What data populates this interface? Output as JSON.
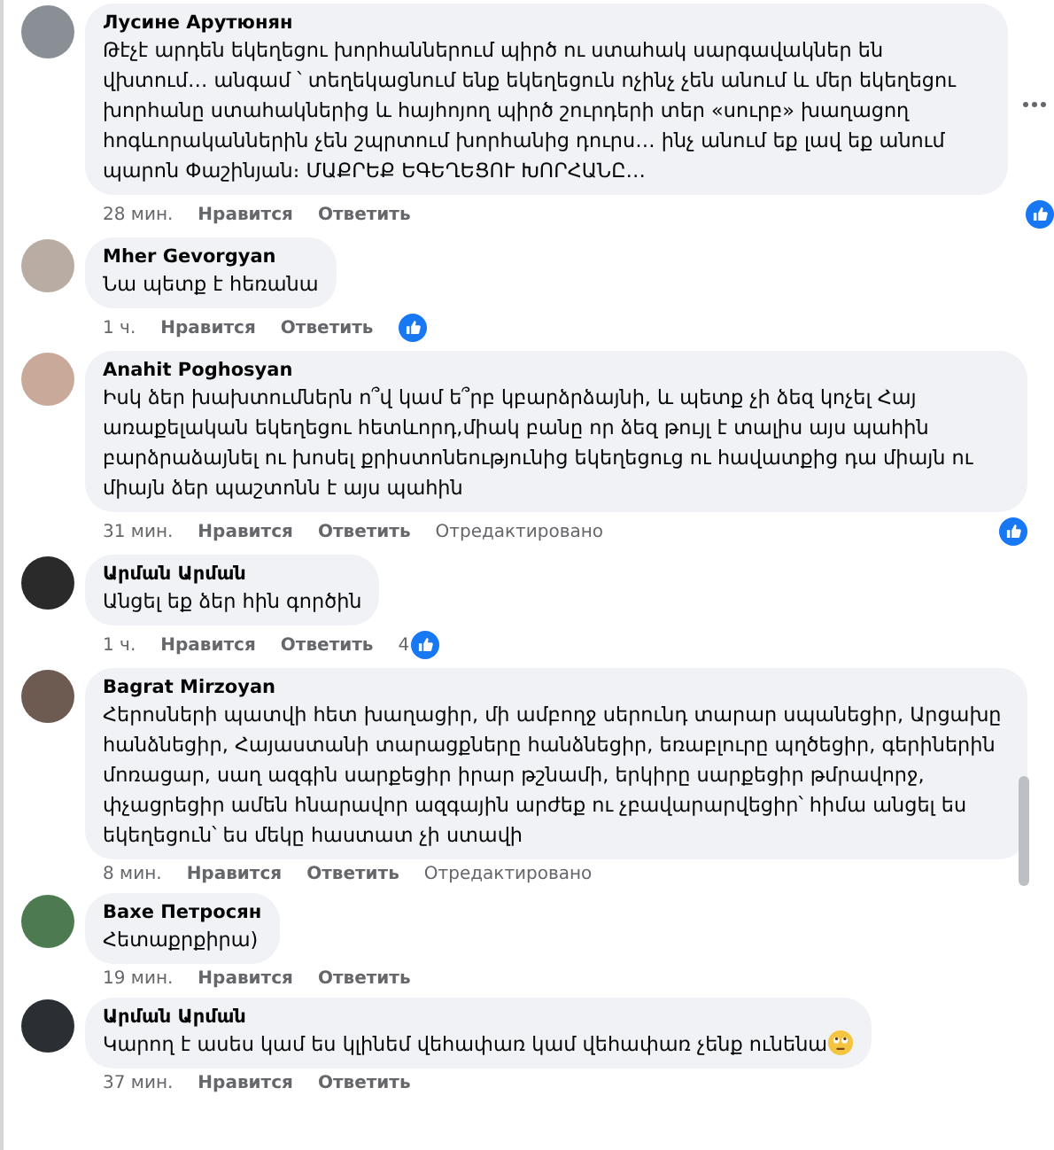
{
  "comments": [
    {
      "author": "Лусине Арутюнян",
      "text": "Թէչէ արդեն եկեղեցու խորհաններում պիրծ ու ստահակ սարգավակներ են վխտում… անգամ ՝ տեղեկացնում ենք եկեղեցուն ոչինչ չեն անում և մեր եկեղեցու խորհանը ստահակներից և հայհոյող պիրծ շուրդերի տեր «սուրբ» խաղացող հոգևորականներին չեն շպրտում խորհանից դուրս… ինչ անում եք լավ եք անում պարոն Փաշինյան։ ՄԱՔՐԵՔ ԵԳԵՂԵՑՈՒ ԽՈՐՀԱՆԸ…",
      "time": "28 мин.",
      "like": "Нравится",
      "reply": "Ответить",
      "has_menu": true,
      "reaction": true
    },
    {
      "author": "Mher Gevorgyan",
      "text": "Նա պետք է հեռանա",
      "time": "1 ч.",
      "like": "Нравится",
      "reply": "Ответить",
      "reaction": true
    },
    {
      "author": "Anahit Poghosyan",
      "text": "Իսկ ձեր խախտումներն ո՞վ կամ ե՞րբ կբարձրձայնի, և պետք չի ձեզ կոչել Հայ առաքելական եկեղեցու հետևորդ,միակ բանը որ ձեզ թույլ է տալիս այս պահին բարձրաձայնել ու խոսել քրիստոնեությունից եկեղեցուց ու հավատքից դա միայն ու միայն ձեր պաշտոնն է այս պահին",
      "time": "31 мин.",
      "like": "Нравится",
      "reply": "Ответить",
      "edited": "Отредактировано",
      "reaction": true
    },
    {
      "author": "Արման Արման",
      "text": "Անցել եք ձեր հին գործին",
      "time": "1 ч.",
      "like": "Нравится",
      "reply": "Ответить",
      "reaction": true,
      "reaction_count": "4"
    },
    {
      "author": "Bagrat Mirzoyan",
      "text": "Հերոսների պատվի հետ խաղացիր, մի ամբողջ սերունդ տարար սպանեցիր, Արցախը հանձնեցիր, Հայաստանի տարացքները հանձնեցիր, եռաբլուրը պղծեցիր, գերիներին մոռացար, սաղ ազգին սարքեցիր իրար թշնամի, երկիրը սարքեցիր թմրավորջ, փչացրեցիր ամեն հնարավոր ազգային արժեք ու չբավարարվեցիր՝ հիմա անցել ես եկեղեցուն՝ ես մեկը հաստատ չի ստավի",
      "time": "8 мин.",
      "like": "Нравится",
      "reply": "Ответить",
      "edited": "Отредактировано"
    },
    {
      "author": "Вахе Петросян",
      "text": "Հետաքրքիրա)",
      "time": "19 мин.",
      "like": "Нравится",
      "reply": "Ответить"
    },
    {
      "author": "Արման Արման",
      "text": "Կարող է ասես կամ ես կլինեմ վեհափառ կամ վեհափառ չենք ունենա",
      "has_emoji": true,
      "time": "37 мин.",
      "like": "Нравится",
      "reply": "Ответить"
    }
  ]
}
